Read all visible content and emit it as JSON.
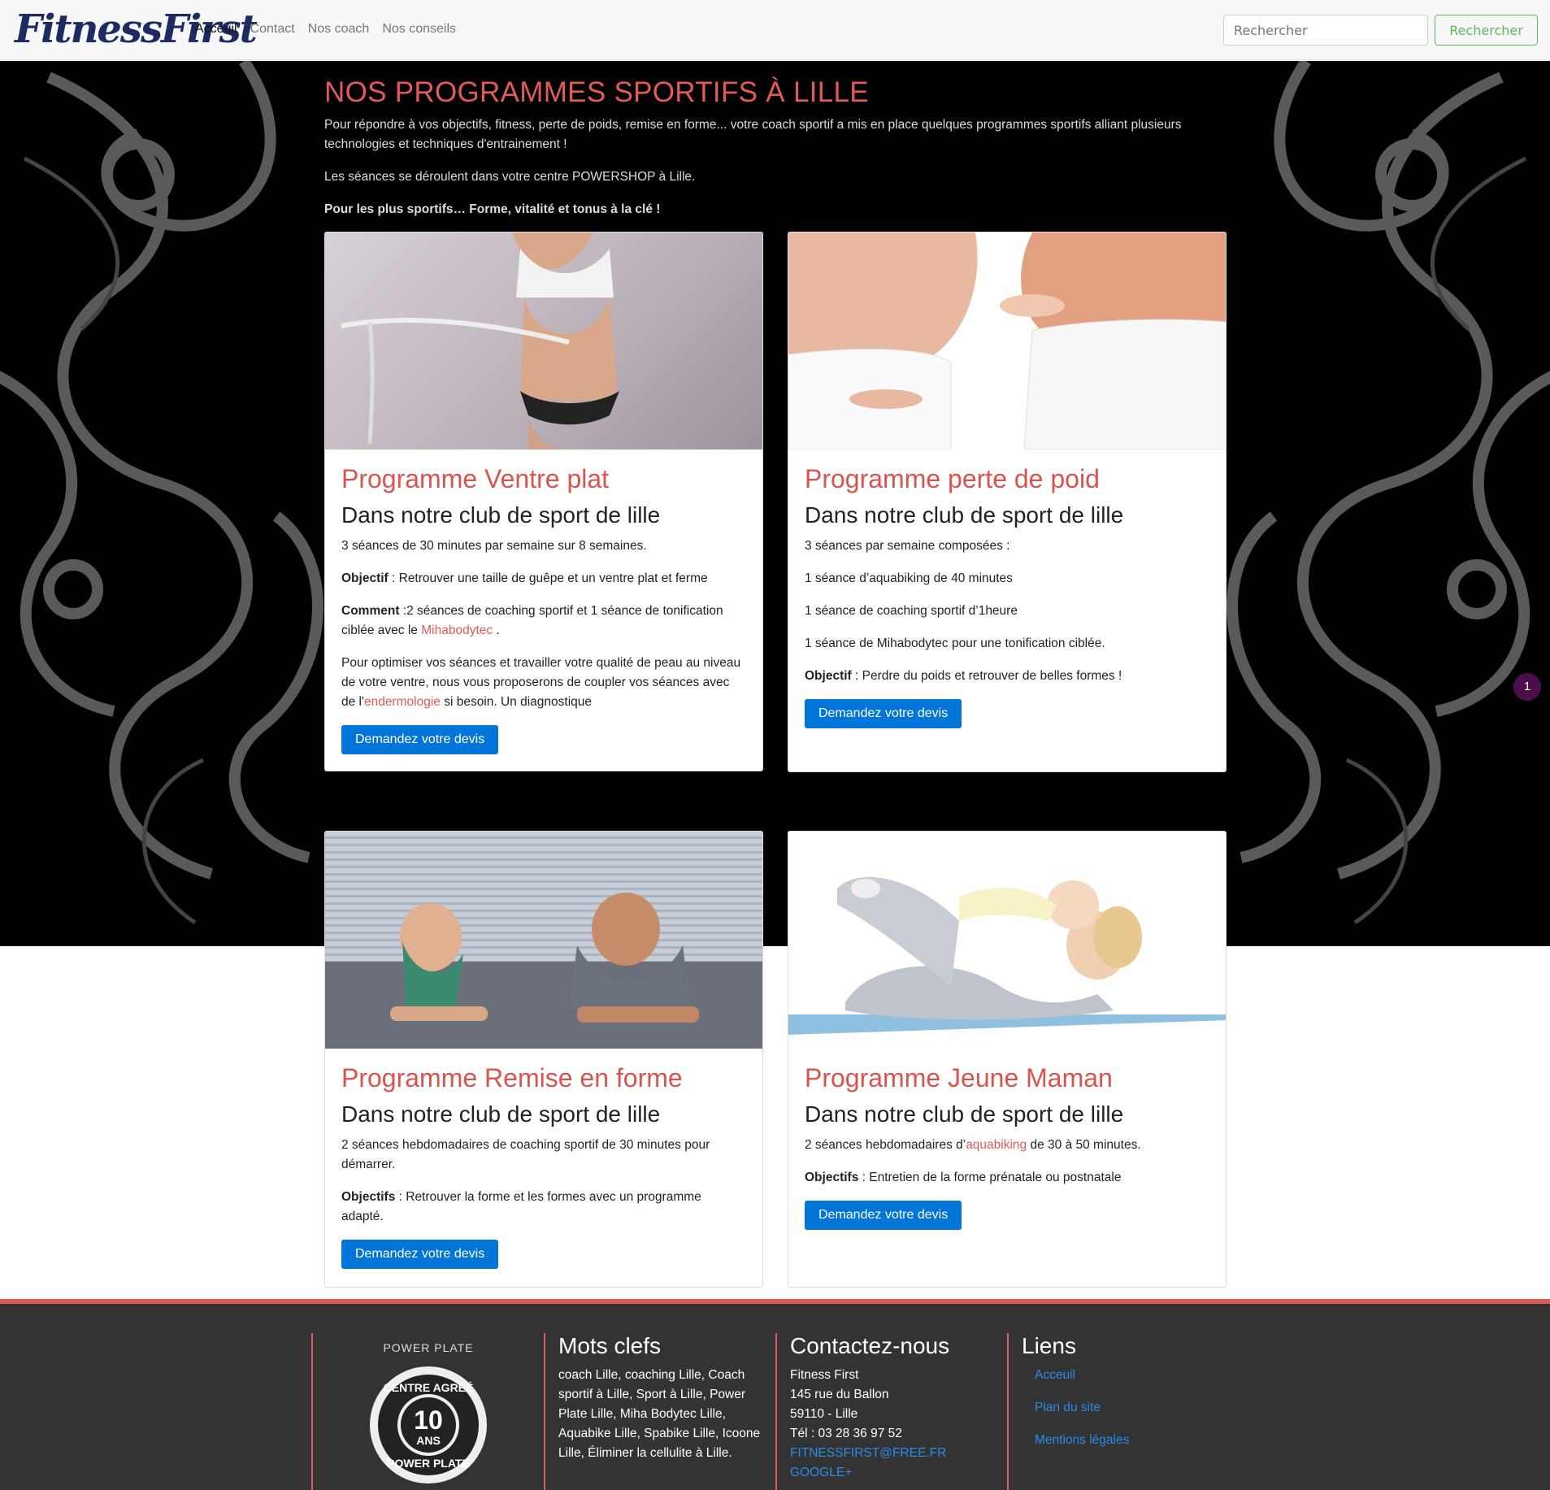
{
  "nav": {
    "logo": "FitnessFirst",
    "links": [
      "Acceuil",
      "Contact",
      "Nos coach",
      "Nos conseils"
    ],
    "search_placeholder": "Rechercher",
    "search_button": "Rechercher"
  },
  "intro": {
    "title": "NOS PROGRAMMES SPORTIFS À LILLE",
    "p1": "Pour répondre à vos objectifs, fitness, perte de poids, remise en forme... votre coach sportif a mis en place quelques programmes sportifs alliant plusieurs technologies et techniques d'entrainement !",
    "p2": "Les séances se déroulent dans votre centre POWERSHOP à Lille.",
    "p3": "Pour les plus sportifs… Forme, vitalité et tonus à la clé !"
  },
  "cards": [
    {
      "title": "Programme Ventre plat",
      "subtitle": "Dans notre club de sport de lille",
      "p1": "3 séances de 30 minutes par semaine sur 8 semaines.",
      "objectif_label": "Objectif",
      "objectif_text": " : Retrouver une taille de guêpe et un ventre plat et ferme",
      "comment_label": "Comment",
      "comment_text": " :2 séances de coaching sportif et 1 séance de tonification ciblée avec le ",
      "comment_link": "Mihabodytec",
      "comment_end": " .",
      "p4_start": "Pour optimiser vos séances et travailler votre qualité de peau au niveau de votre ventre, nous vous proposerons de coupler vos séances avec de l'",
      "p4_link": "endermologie",
      "p4_end": " si besoin. Un diagnostique",
      "button": "Demandez votre devis"
    },
    {
      "title": "Programme perte de poid",
      "subtitle": "Dans notre club de sport de lille",
      "p1": "3 séances par semaine composées :",
      "p2": "1 séance d’aquabiking de 40 minutes",
      "p3": "1 séance de coaching sportif d’1heure",
      "p4": "1 séance de Mihabodytec pour une tonification ciblée.",
      "objectif_label": "Objectif",
      "objectif_text": " : Perdre du poids et retrouver de belles formes !",
      "button": "Demandez votre devis"
    },
    {
      "title": "Programme Remise en forme",
      "subtitle": "Dans notre club de sport de lille",
      "p1": "2 séances hebdomadaires de coaching sportif de 30 minutes pour démarrer.",
      "objectif_label": "Objectifs",
      "objectif_text": " : Retrouver la forme et les formes avec un programme adapté.",
      "button": "Demandez votre devis"
    },
    {
      "title": "Programme Jeune Maman",
      "subtitle": "Dans notre club de sport de lille",
      "p1_start": "2 séances hebdomadaires d’",
      "p1_link": "aquabiking",
      "p1_end": " de 30 à 50 minutes.",
      "objectif_label": "Objectifs",
      "objectif_text": " : Entretien de la forme prénatale ou postnatale",
      "button": "Demandez votre devis"
    }
  ],
  "floating_badge": "1",
  "footer": {
    "badge": {
      "brand": "POWER PLATE",
      "top": "CENTRE AGRÉÉ",
      "number": "10",
      "unit": "ANS",
      "bottom": "POWER PLATE"
    },
    "keywords_title": "Mots clefs",
    "keywords_text": "coach Lille, coaching Lille, Coach sportif à Lille, Sport à Lille, Power Plate Lille, Miha Bodytec Lille, Aquabike Lille, Spabike Lille, Icoone Lille, Éliminer la cellulite à Lille.",
    "contact_title": "Contactez-nous",
    "contact_lines": [
      "Fitness First",
      "145 rue du Ballon",
      "59110 - Lille",
      "Tél : 03 28 36 97 52"
    ],
    "contact_email": "FITNESSFIRST@FREE.FR",
    "contact_google": "GOOGLE+",
    "links_title": "Liens",
    "links": [
      "Acceuil",
      "Plan du site",
      "Mentions légales"
    ]
  },
  "colors": {
    "accent": "#e05a5a",
    "primary": "#0275d8",
    "success": "#5cb85c",
    "footer_bg": "#333333"
  }
}
